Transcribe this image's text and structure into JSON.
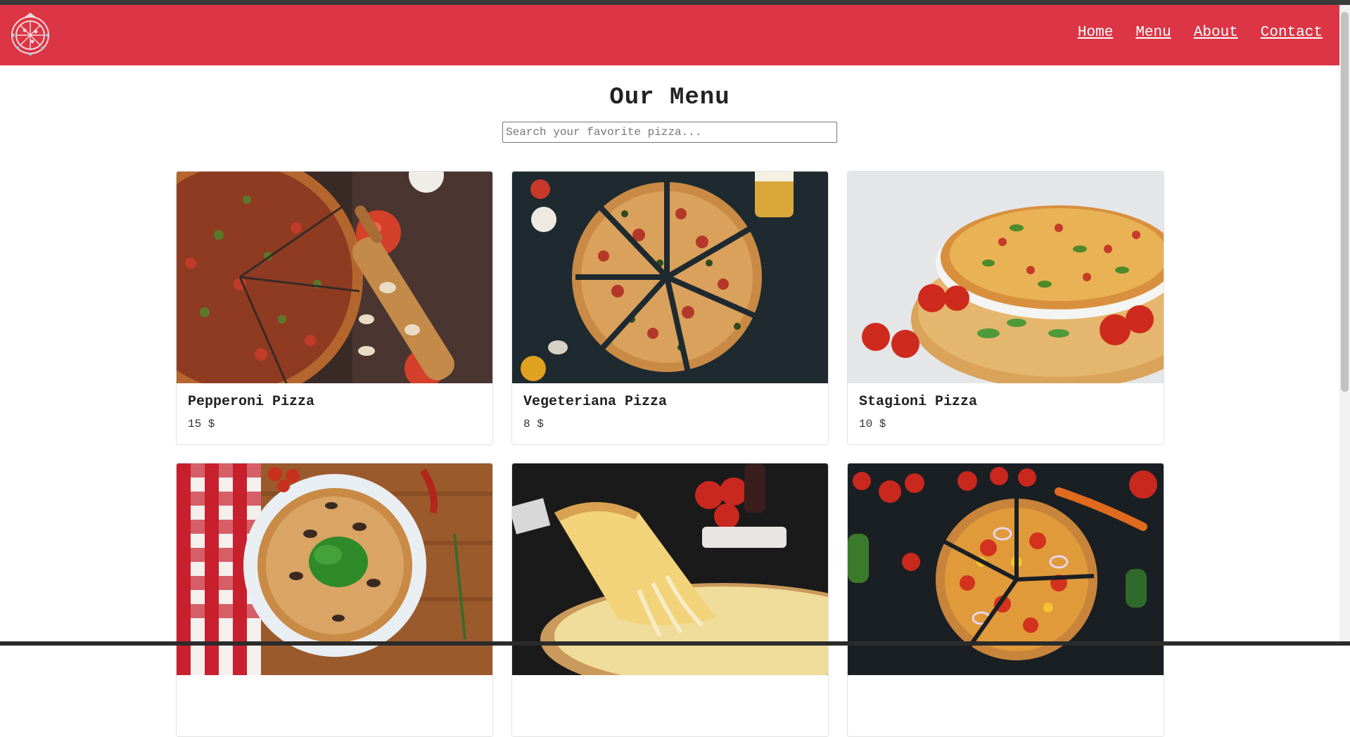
{
  "navbar": {
    "background": "#dc3545",
    "logo_icon": "pizza-logo-icon",
    "links": [
      "Home",
      "Menu",
      "About",
      "Contact"
    ]
  },
  "main": {
    "title": "Our Menu",
    "search": {
      "placeholder": "Search your favorite pizza...",
      "value": ""
    },
    "items": [
      {
        "name": "Pepperoni Pizza",
        "price": "15 $",
        "image": "pepperoni-pizza-photo"
      },
      {
        "name": "Vegeteriana Pizza",
        "price": "8 $",
        "image": "vegetarian-pizza-photo"
      },
      {
        "name": "Stagioni Pizza",
        "price": "10 $",
        "image": "stagioni-pizza-photo"
      },
      {
        "name": "",
        "price": "",
        "image": "spinach-pizza-photo"
      },
      {
        "name": "",
        "price": "",
        "image": "cheese-pizza-slice-photo"
      },
      {
        "name": "",
        "price": "",
        "image": "tomato-pizza-photo"
      }
    ]
  }
}
